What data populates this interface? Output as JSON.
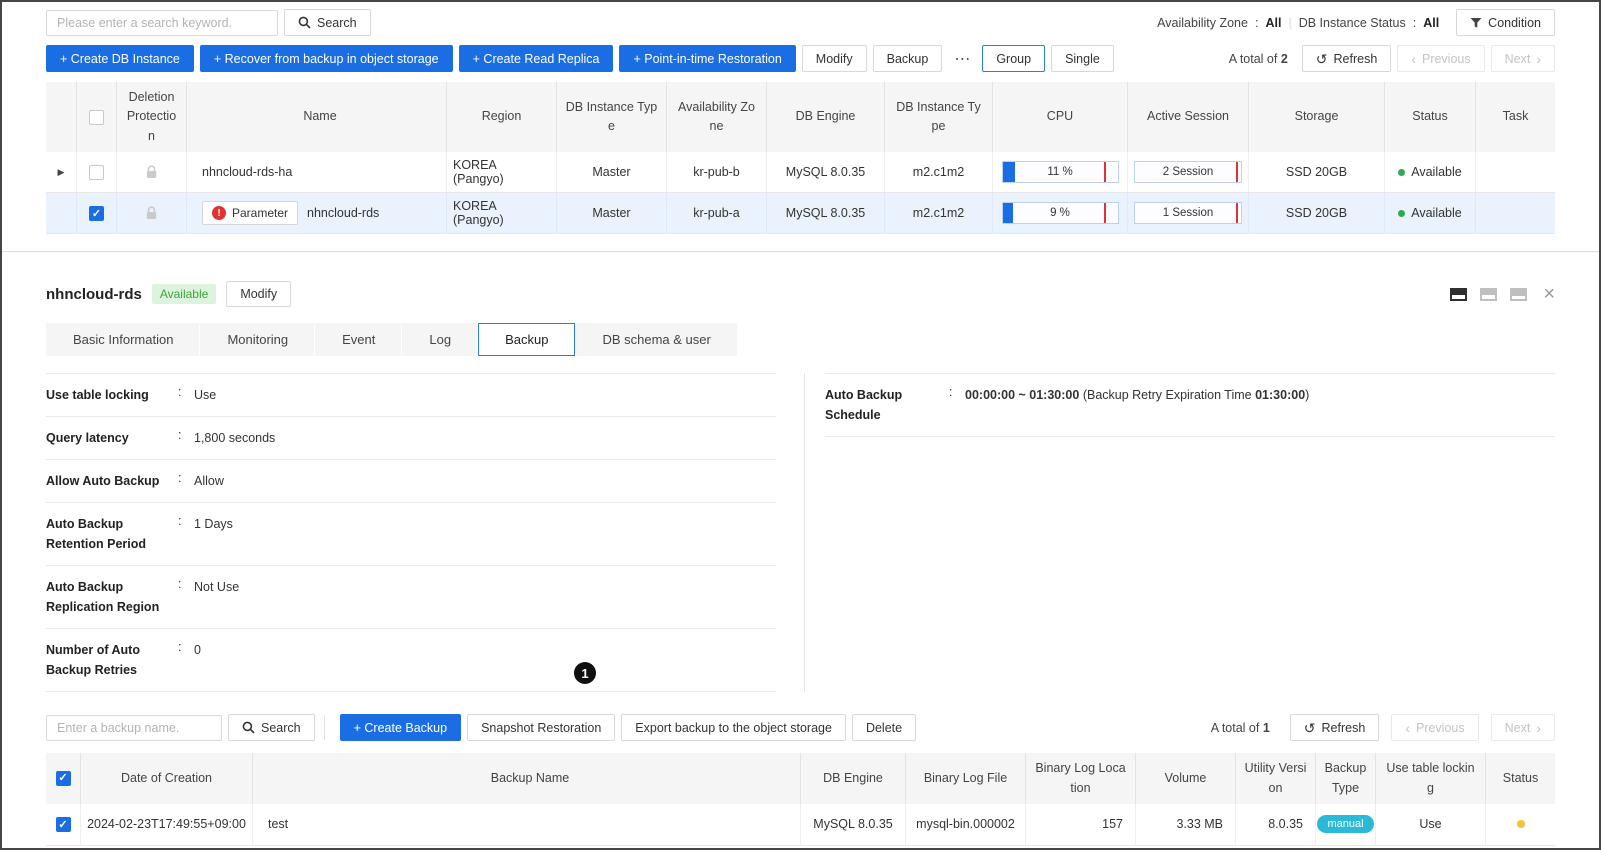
{
  "colors": {
    "primary_blue": "#1a6de3",
    "selected_row_bg": "#e9f2fd",
    "status_green": "#2fa84f",
    "badge_green_bg": "#def3de",
    "badge_green_text": "#3aa63a",
    "manual_badge_cyan": "#2bb9d9",
    "status_yellow": "#f2c437",
    "threshold_red": "#dd3333"
  },
  "icons": {
    "more": "⋯",
    "previous_chevron": "‹",
    "next_chevron": "›",
    "refresh": "↺",
    "close": "×",
    "expand_arrow": "▶",
    "check": "✓",
    "exclamation": "!"
  },
  "punctuation": {
    "colon": ":",
    "pipe": "|"
  },
  "top_toolbar": {
    "search_placeholder": "Please enter a search keyword.",
    "search_button": "Search",
    "availability_zone_label": "Availability Zone",
    "availability_zone_value": "All",
    "db_instance_status_label": "DB Instance Status",
    "db_instance_status_value": "All",
    "condition_button": "Condition"
  },
  "action_bar": {
    "create_db_instance": "+ Create DB Instance",
    "recover_from_backup": "+ Recover from backup in object storage",
    "create_read_replica": "+ Create Read Replica",
    "point_in_time_restoration": "+ Point-in-time Restoration",
    "modify": "Modify",
    "backup": "Backup",
    "group": "Group",
    "single": "Single",
    "total_label": "A total of",
    "total_count": "2",
    "refresh": "Refresh",
    "previous": "Previous",
    "next": "Next"
  },
  "instances_table": {
    "headers": {
      "deletion_protection": "Deletion Protection",
      "name": "Name",
      "region": "Region",
      "db_instance_type": "DB Instance Type",
      "availability_zone": "Availability Zone",
      "db_engine": "DB Engine",
      "db_instance_type_2": "DB Instance Type",
      "cpu": "CPU",
      "active_session": "Active Session",
      "storage": "Storage",
      "status": "Status",
      "task": "Task"
    },
    "rows": [
      {
        "name": "nhncloud-rds-ha",
        "region": "KOREA (Pangyo)",
        "db_instance_type": "Master",
        "availability_zone": "kr-pub-b",
        "db_engine": "MySQL 8.0.35",
        "db_instance_type_2": "m2.c1m2",
        "cpu_label": "11 %",
        "cpu_fill": "11%",
        "session_label": "2 Session",
        "storage": "SSD 20GB",
        "status": "Available",
        "task": ""
      },
      {
        "name": "nhncloud-rds",
        "parameter_badge": "Parameter",
        "region": "KOREA (Pangyo)",
        "db_instance_type": "Master",
        "availability_zone": "kr-pub-a",
        "db_engine": "MySQL 8.0.35",
        "db_instance_type_2": "m2.c1m2",
        "cpu_label": "9 %",
        "cpu_fill": "9%",
        "session_label": "1 Session",
        "storage": "SSD 20GB",
        "status": "Available",
        "task": ""
      }
    ]
  },
  "detail_panel": {
    "title": "nhncloud-rds",
    "status_badge": "Available",
    "modify_button": "Modify",
    "tabs": {
      "basic_information": "Basic Information",
      "monitoring": "Monitoring",
      "event": "Event",
      "log": "Log",
      "backup": "Backup",
      "db_schema_user": "DB schema & user"
    },
    "active_tab": "Backup",
    "info_left": [
      {
        "label": "Use table locking",
        "value": "Use"
      },
      {
        "label": "Query latency",
        "value": "1,800 seconds"
      },
      {
        "label": "Allow Auto Backup",
        "value": "Allow"
      },
      {
        "label": "Auto Backup Retention Period",
        "value": "1 Days"
      },
      {
        "label": "Auto Backup Replication Region",
        "value": "Not Use"
      },
      {
        "label": "Number of Auto Backup Retries",
        "value": "0"
      }
    ],
    "info_right": {
      "label": "Auto Backup Schedule",
      "time_range": "00:00:00 ~ 01:30:00",
      "retry_prefix": "(Backup Retry Expiration Time",
      "retry_time": "01:30:00",
      "retry_suffix": ")"
    }
  },
  "backup_toolbar": {
    "search_placeholder": "Enter a backup name.",
    "search_button": "Search",
    "create_backup": "+ Create Backup",
    "snapshot_restoration": "Snapshot Restoration",
    "export_backup": "Export backup to the object storage",
    "delete": "Delete",
    "total_label": "A total of",
    "total_count": "1",
    "refresh": "Refresh",
    "previous": "Previous",
    "next": "Next",
    "annotation_marker": "1"
  },
  "backups_table": {
    "headers": {
      "date_of_creation": "Date of Creation",
      "backup_name": "Backup Name",
      "db_engine": "DB Engine",
      "binary_log_file": "Binary Log File",
      "binary_log_location": "Binary Log Location",
      "volume": "Volume",
      "utility_version": "Utility Version",
      "backup_type": "Backup Type",
      "use_table_locking": "Use table locking",
      "status": "Status"
    },
    "rows": [
      {
        "date_of_creation": "2024-02-23T17:49:55+09:00",
        "backup_name": "test",
        "db_engine": "MySQL 8.0.35",
        "binary_log_file": "mysql-bin.000002",
        "binary_log_location": "157",
        "volume": "3.33 MB",
        "utility_version": "8.0.35",
        "backup_type": "manual",
        "use_table_locking": "Use"
      }
    ]
  }
}
